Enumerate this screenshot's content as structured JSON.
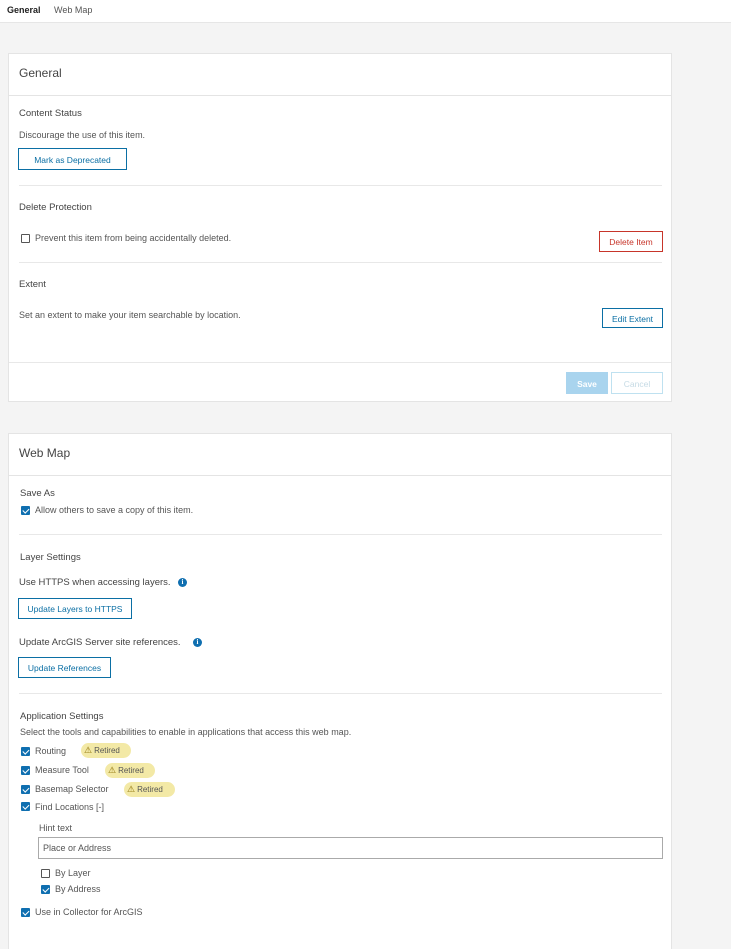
{
  "tabs": [
    "General",
    "Web Map"
  ],
  "general": {
    "title": "General",
    "content_status": {
      "heading": "Content Status",
      "text": "Discourage the use of this item.",
      "button": "Mark as Deprecated"
    },
    "delete_protection": {
      "heading": "Delete Protection",
      "checkbox_label": "Prevent this item from being accidentally deleted.",
      "checked": false,
      "button": "Delete Item"
    },
    "extent": {
      "heading": "Extent",
      "text": "Set an extent to make your item searchable by location.",
      "button": "Edit Extent"
    },
    "save_label": "Save",
    "cancel_label": "Cancel"
  },
  "webmap": {
    "title": "Web Map",
    "save_as": {
      "heading": "Save As",
      "checkbox_label": "Allow others to save a copy of this item.",
      "checked": true
    },
    "layer_settings": {
      "heading": "Layer Settings",
      "https_text": "Use HTTPS when accessing layers.",
      "https_button": "Update Layers to HTTPS",
      "refs_text": "Update ArcGIS Server site references.",
      "refs_button": "Update References",
      "info_glyph": "i"
    },
    "app_settings": {
      "heading": "Application Settings",
      "text": "Select the tools and capabilities to enable in applications that access this web map.",
      "routing": "Routing",
      "measure": "Measure Tool",
      "basemap": "Basemap Selector",
      "find_locations": "Find Locations [-]",
      "retired": "Retired",
      "warn_glyph": "⚠",
      "hint_label": "Hint text",
      "hint_value": "Place or Address",
      "by_layer": "By Layer",
      "by_address": "By Address",
      "collector": "Use in Collector for ArcGIS"
    }
  },
  "colors": {
    "accent": "#0f6fb0",
    "danger": "#c7352a",
    "retired_badge": "#f3e9a6"
  }
}
